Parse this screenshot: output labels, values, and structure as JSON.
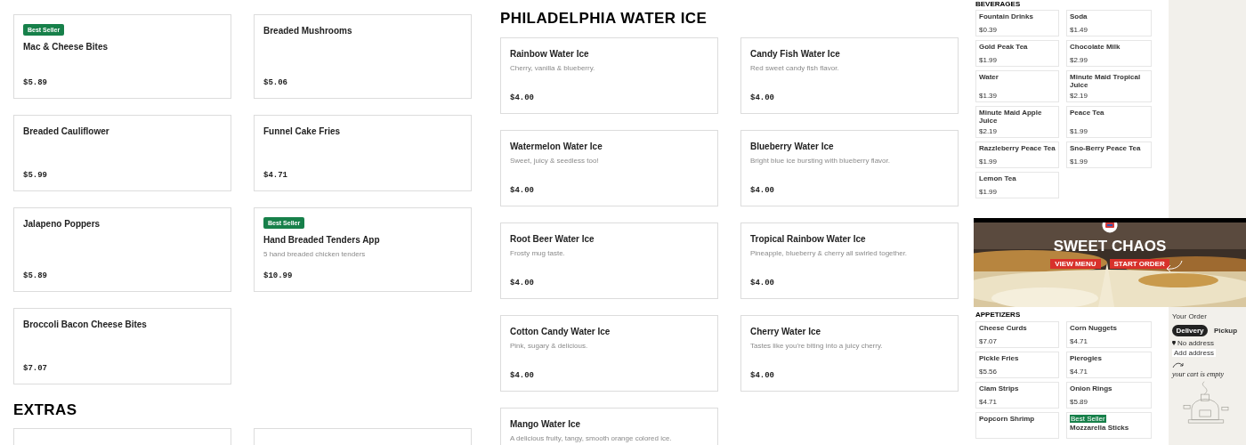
{
  "left_panel": {
    "items": [
      {
        "title": "Mac & Cheese Bites",
        "badge": "Best Seller",
        "price": "$5.89"
      },
      {
        "title": "Breaded Mushrooms",
        "price": "$5.06"
      },
      {
        "title": "Breaded Cauliflower",
        "price": "$5.99"
      },
      {
        "title": "Funnel Cake Fries",
        "price": "$4.71"
      },
      {
        "title": "Jalapeno Poppers",
        "price": "$5.89"
      },
      {
        "title": "Hand Breaded Tenders App",
        "badge": "Best Seller",
        "description": "5 hand breaded chicken tenders",
        "price": "$10.99"
      },
      {
        "title": "Broccoli Bacon Cheese Bites",
        "price": "$7.07"
      }
    ],
    "next_heading": "EXTRAS"
  },
  "water_ice": {
    "heading": "PHILADELPHIA WATER ICE",
    "items": [
      {
        "title": "Rainbow Water Ice",
        "description": "Cherry, vanilla & blueberry.",
        "price": "$4.00"
      },
      {
        "title": "Candy Fish Water Ice",
        "description": "Red sweet candy fish flavor.",
        "price": "$4.00"
      },
      {
        "title": "Watermelon Water Ice",
        "description": "Sweet, juicy & seedless too!",
        "price": "$4.00"
      },
      {
        "title": "Blueberry Water Ice",
        "description": "Bright blue ice bursting with blueberry flavor.",
        "price": "$4.00"
      },
      {
        "title": "Root Beer Water Ice",
        "description": "Frosty mug taste.",
        "price": "$4.00"
      },
      {
        "title": "Tropical Rainbow Water Ice",
        "description": "Pineapple, blueberry & cherry all swirled together.",
        "price": "$4.00"
      },
      {
        "title": "Cotton Candy Water Ice",
        "description": "Pink, sugary & delicious.",
        "price": "$4.00"
      },
      {
        "title": "Cherry Water Ice",
        "description": "Tastes like you're biting into a juicy cherry.",
        "price": "$4.00"
      },
      {
        "title": "Mango Water Ice",
        "description": "A delicious fruity, tangy, smooth orange colored ice."
      }
    ]
  },
  "beverages_thumbnail": {
    "heading": "BEVERAGES",
    "items": [
      {
        "title": "Fountain Drinks",
        "price": "$0.39"
      },
      {
        "title": "Soda",
        "price": "$1.49"
      },
      {
        "title": "Gold Peak Tea",
        "price": "$1.99"
      },
      {
        "title": "Chocolate Milk",
        "price": "$2.99"
      },
      {
        "title": "Water",
        "price": "$1.39"
      },
      {
        "title": "Minute Maid Tropical Juice",
        "price": "$2.19"
      },
      {
        "title": "Minute Maid Apple Juice",
        "price": "$2.19"
      },
      {
        "title": "Peace Tea",
        "price": "$1.99"
      },
      {
        "title": "Razzleberry Peace Tea",
        "price": "$1.99"
      },
      {
        "title": "Sno-Berry Peace Tea",
        "price": "$1.99"
      },
      {
        "title": "Lemon Tea",
        "price": "$1.99"
      }
    ]
  },
  "home_thumbnail": {
    "hero": {
      "title": "SWEET CHAOS",
      "buttons": [
        "VIEW MENU",
        "START ORDER"
      ]
    },
    "appetizers": {
      "heading": "APPETIZERS",
      "items": [
        {
          "title": "Cheese Curds",
          "price": "$7.07"
        },
        {
          "title": "Corn Nuggets",
          "price": "$4.71"
        },
        {
          "title": "Pickle Fries",
          "price": "$5.56"
        },
        {
          "title": "Pierogies",
          "price": "$4.71"
        },
        {
          "title": "Clam Strips",
          "price": "$4.71"
        },
        {
          "title": "Onion Rings",
          "price": "$5.89"
        },
        {
          "title": "Popcorn Shrimp"
        },
        {
          "title": "Mozzarella Sticks",
          "badge": "Best Seller"
        }
      ]
    },
    "order": {
      "title": "Your Order",
      "modes": [
        {
          "label": "Delivery",
          "selected": true
        },
        {
          "label": "Pickup",
          "selected": false
        }
      ],
      "address": "No address",
      "address_button": "Add address",
      "empty_message": "your cart is empty"
    }
  }
}
